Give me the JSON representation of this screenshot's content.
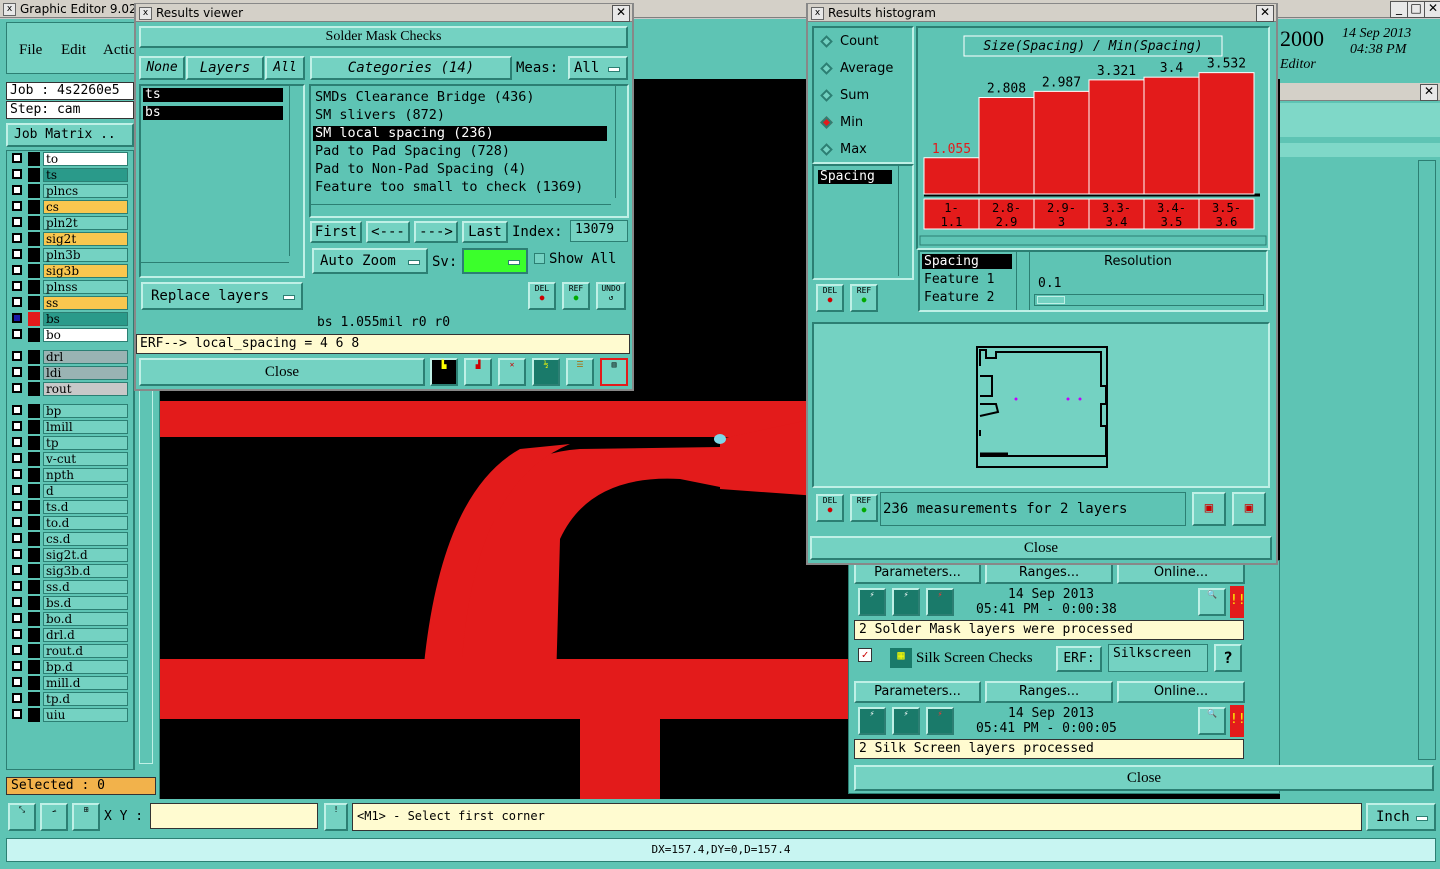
{
  "main_window": {
    "title": "Graphic Editor 9.02",
    "menu": [
      "File",
      "Edit",
      "Actio"
    ],
    "job_label": "Job : 4s2260e5",
    "step_label": "Step: cam",
    "job_matrix": "Job Matrix ..",
    "layers": [
      {
        "name": "to",
        "color": "#ffffff",
        "sw": "#000000"
      },
      {
        "name": "ts",
        "color": "#2a9a8a",
        "sw": "#000000"
      },
      {
        "name": "plncs",
        "color": "#74d2c2",
        "sw": "#000000"
      },
      {
        "name": "cs",
        "color": "#f9c74f",
        "sw": "#000000"
      },
      {
        "name": "pln2t",
        "color": "#74d2c2",
        "sw": "#000000"
      },
      {
        "name": "sig2t",
        "color": "#f9c74f",
        "sw": "#000000"
      },
      {
        "name": "pln3b",
        "color": "#74d2c2",
        "sw": "#000000"
      },
      {
        "name": "sig3b",
        "color": "#f9c74f",
        "sw": "#000000"
      },
      {
        "name": "plnss",
        "color": "#74d2c2",
        "sw": "#000000"
      },
      {
        "name": "ss",
        "color": "#f9c74f",
        "sw": "#000000"
      },
      {
        "name": "bs",
        "color": "#2a9a8a",
        "sw": "#e31b1b"
      },
      {
        "name": "bo",
        "color": "#ffffff",
        "sw": "#000000"
      },
      {
        "name": "drl",
        "color": "#9ab3b3",
        "sw": "#000000"
      },
      {
        "name": "ldi",
        "color": "#9ab3b3",
        "sw": "#000000"
      },
      {
        "name": "rout",
        "color": "#c8c8c8",
        "sw": "#000000"
      },
      {
        "name": "bp",
        "color": "#74d2c2",
        "sw": "#000000"
      },
      {
        "name": "lmill",
        "color": "#74d2c2",
        "sw": "#000000"
      },
      {
        "name": "tp",
        "color": "#74d2c2",
        "sw": "#000000"
      },
      {
        "name": "v-cut",
        "color": "#74d2c2",
        "sw": "#000000"
      },
      {
        "name": "npth",
        "color": "#74d2c2",
        "sw": "#000000"
      },
      {
        "name": "d",
        "color": "#74d2c2",
        "sw": "#000000"
      },
      {
        "name": "ts.d",
        "color": "#74d2c2",
        "sw": "#000000"
      },
      {
        "name": "to.d",
        "color": "#74d2c2",
        "sw": "#000000"
      },
      {
        "name": "cs.d",
        "color": "#74d2c2",
        "sw": "#000000"
      },
      {
        "name": "sig2t.d",
        "color": "#74d2c2",
        "sw": "#000000"
      },
      {
        "name": "sig3b.d",
        "color": "#74d2c2",
        "sw": "#000000"
      },
      {
        "name": "ss.d",
        "color": "#74d2c2",
        "sw": "#000000"
      },
      {
        "name": "bs.d",
        "color": "#74d2c2",
        "sw": "#000000"
      },
      {
        "name": "bo.d",
        "color": "#74d2c2",
        "sw": "#000000"
      },
      {
        "name": "drl.d",
        "color": "#74d2c2",
        "sw": "#000000"
      },
      {
        "name": "rout.d",
        "color": "#74d2c2",
        "sw": "#000000"
      },
      {
        "name": "bp.d",
        "color": "#74d2c2",
        "sw": "#000000"
      },
      {
        "name": "mill.d",
        "color": "#74d2c2",
        "sw": "#000000"
      },
      {
        "name": "tp.d",
        "color": "#74d2c2",
        "sw": "#000000"
      },
      {
        "name": "uiu",
        "color": "#74d2c2",
        "sw": "#000000"
      }
    ],
    "selected": "Selected : 0",
    "xy_label": "X Y :",
    "xy_value": "",
    "hint": "<M1> - Select first corner",
    "units": "Inch",
    "status": "DX=157.4,DY=0,D=157.4",
    "header_year": "2000",
    "header_date": "14 Sep 2013",
    "header_time": "04:38 PM",
    "header_editor": "Editor"
  },
  "results_viewer": {
    "title": "Results viewer",
    "heading": "Solder Mask Checks",
    "filter_none": "None",
    "filter_layers": "Layers",
    "filter_all": "All",
    "categories_btn": "Categories (14)",
    "meas_label": "Meas:",
    "meas_value": "All",
    "layers": [
      "ts",
      "bs"
    ],
    "categories": [
      "SMDs Clearance Bridge (436)",
      "SM slivers (872)",
      "SM local spacing (236)",
      "Pad to Pad Spacing (728)",
      "Pad to Non-Pad Spacing (4)",
      "Feature too small to check (1369)"
    ],
    "selected_category": 2,
    "first_btn": "First",
    "prev_btn": "<---",
    "next_btn": "--->",
    "last_btn": "Last",
    "index_label": "Index:",
    "index_value": "13079",
    "auto_zoom": "Auto Zoom",
    "sv_label": "Sv:",
    "show_all": "Show All",
    "replace_layers": "Replace layers",
    "info_line": "bs 1.055mil  r0  r0",
    "erf_line": "ERF--> local_spacing = 4 6 8",
    "close": "Close",
    "del": "DEL",
    "ref": "REF",
    "undo": "UNDO"
  },
  "histogram": {
    "title": "Results histogram",
    "stats": [
      "Count",
      "Average",
      "Sum",
      "Min",
      "Max"
    ],
    "selected_stat": 3,
    "list_item": "Spacing",
    "del": "DEL",
    "ref": "REF",
    "measure_list": [
      "Spacing",
      "Feature 1",
      "Feature 2"
    ],
    "resolution_label": "Resolution",
    "resolution_value": "0.1",
    "measurements_text": "236 measurements for 2 layers",
    "close": "Close"
  },
  "chart_data": {
    "type": "bar",
    "title": "Size(Spacing) / Min(Spacing)",
    "categories": [
      "1-1.1",
      "2.8-2.9",
      "2.9-3",
      "3.3-3.4",
      "3.4-3.5",
      "3.5-3.6"
    ],
    "category_lines": [
      [
        "1-",
        "1.1"
      ],
      [
        "2.8-",
        "2.9"
      ],
      [
        "2.9-",
        "3"
      ],
      [
        "3.3-",
        "3.4"
      ],
      [
        "3.4-",
        "3.5"
      ],
      [
        "3.5-",
        "3.6"
      ]
    ],
    "values": [
      1.055,
      2.808,
      2.987,
      3.321,
      3.4,
      3.532
    ],
    "value_labels": [
      "1.055",
      "2.808",
      "2.987",
      "3.321",
      "3.4",
      "3.532"
    ],
    "ylim": [
      0,
      3.9
    ],
    "bar_color": "#e31b1b"
  },
  "checks_panel": {
    "parameters": "Parameters...",
    "ranges": "Ranges...",
    "online": "Online...",
    "sm_date": "14 Sep 2013",
    "sm_time": "05:41 PM - 0:00:38",
    "sm_status": "2 Solder Mask layers were processed",
    "silk_label": "Silk Screen Checks",
    "erf_label": "ERF:",
    "erf_value": "Silkscreen",
    "help": "?",
    "ss_date": "14 Sep 2013",
    "ss_time": "05:41 PM - 0:00:05",
    "ss_status": "2 Silk Screen layers processed",
    "close": "Close"
  }
}
